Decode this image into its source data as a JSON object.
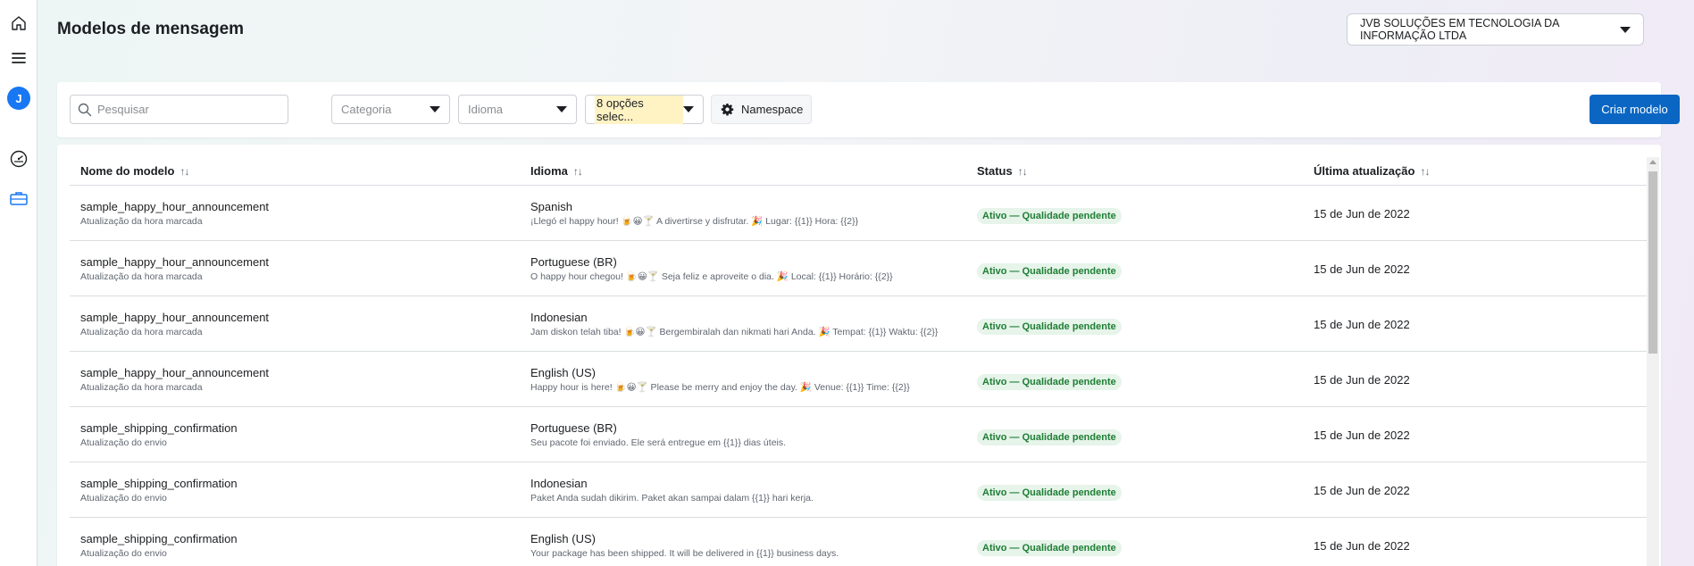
{
  "rail": {
    "items": [
      {
        "icon": "home-icon"
      },
      {
        "icon": "menu-icon"
      },
      {
        "icon": "avatar",
        "letter": "J"
      },
      {
        "icon": "gauge-icon"
      },
      {
        "icon": "briefcase-icon"
      }
    ],
    "active_color": "#1877f2"
  },
  "header": {
    "title": "Modelos de mensagem",
    "account": "JVB SOLUÇÕES EM TECNOLOGIA DA INFORMAÇÃO LTDA"
  },
  "filters": {
    "search_placeholder": "Pesquisar",
    "categoria": "Categoria",
    "idioma": "Idioma",
    "status_selected": "8 opções selec...",
    "namespace_label": "Namespace",
    "create_label": "Criar modelo"
  },
  "table": {
    "columns": {
      "name": "Nome do modelo",
      "language": "Idioma",
      "status": "Status",
      "updated": "Última atualização"
    },
    "sort_icon": "↑↓",
    "rows": [
      {
        "name": "sample_happy_hour_announcement",
        "sub": "Atualização da hora marcada",
        "language": "Spanish",
        "preview": "¡Llegó el happy hour! 🍺😀🍸 A divertirse y disfrutar. 🎉 Lugar: {{1}} Hora: {{2}}",
        "status": "Ativo — Qualidade pendente",
        "date": "15 de Jun de 2022"
      },
      {
        "name": "sample_happy_hour_announcement",
        "sub": "Atualização da hora marcada",
        "language": "Portuguese (BR)",
        "preview": "O happy hour chegou! 🍺😀🍸 Seja feliz e aproveite o dia. 🎉 Local: {{1}} Horário: {{2}}",
        "status": "Ativo — Qualidade pendente",
        "date": "15 de Jun de 2022"
      },
      {
        "name": "sample_happy_hour_announcement",
        "sub": "Atualização da hora marcada",
        "language": "Indonesian",
        "preview": "Jam diskon telah tiba! 🍺😀🍸 Bergembiralah dan nikmati hari Anda. 🎉 Tempat: {{1}} Waktu: {{2}}",
        "status": "Ativo — Qualidade pendente",
        "date": "15 de Jun de 2022"
      },
      {
        "name": "sample_happy_hour_announcement",
        "sub": "Atualização da hora marcada",
        "language": "English (US)",
        "preview": "Happy hour is here! 🍺😀🍸 Please be merry and enjoy the day. 🎉 Venue: {{1}} Time: {{2}}",
        "status": "Ativo — Qualidade pendente",
        "date": "15 de Jun de 2022"
      },
      {
        "name": "sample_shipping_confirmation",
        "sub": "Atualização do envio",
        "language": "Portuguese (BR)",
        "preview": "Seu pacote foi enviado. Ele será entregue em {{1}} dias úteis.",
        "status": "Ativo — Qualidade pendente",
        "date": "15 de Jun de 2022"
      },
      {
        "name": "sample_shipping_confirmation",
        "sub": "Atualização do envio",
        "language": "Indonesian",
        "preview": "Paket Anda sudah dikirim. Paket akan sampai dalam {{1}} hari kerja.",
        "status": "Ativo — Qualidade pendente",
        "date": "15 de Jun de 2022"
      },
      {
        "name": "sample_shipping_confirmation",
        "sub": "Atualização do envio",
        "language": "English (US)",
        "preview": "Your package has been shipped. It will be delivered in {{1}} business days.",
        "status": "Ativo — Qualidade pendente",
        "date": "15 de Jun de 2022"
      }
    ]
  }
}
